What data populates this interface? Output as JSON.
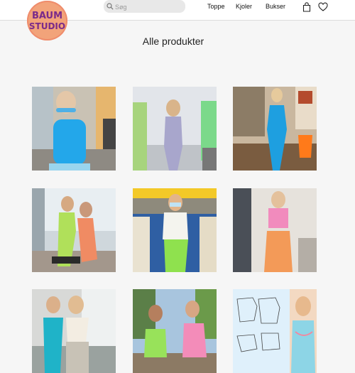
{
  "brand": {
    "logo_text_line1": "BAUM",
    "logo_text_line2": "STUDIO"
  },
  "search": {
    "placeholder": "Søg",
    "value": ""
  },
  "nav": [
    {
      "label": "Toppe"
    },
    {
      "label": "Kjoler"
    },
    {
      "label": "Bukser"
    }
  ],
  "header_icons": [
    "shopping-bag-icon",
    "heart-icon"
  ],
  "page": {
    "title": "Alle produkter"
  },
  "colors": {
    "header_bg": "#ffffff",
    "page_bg": "#f6f6f6",
    "logo_bg": "#f2a37a",
    "logo_text": "#7a2a8a"
  },
  "products": [
    {
      "name": "product-blue-sequin-top"
    },
    {
      "name": "product-lilac-sequin-jumpsuit"
    },
    {
      "name": "product-blue-sequin-set"
    },
    {
      "name": "product-orange-green-outfits"
    },
    {
      "name": "product-green-sequin-pants"
    },
    {
      "name": "product-pink-orange-set"
    },
    {
      "name": "product-turquoise-sequin-top"
    },
    {
      "name": "product-green-pink-tops"
    },
    {
      "name": "product-sewing-pattern-top"
    }
  ]
}
